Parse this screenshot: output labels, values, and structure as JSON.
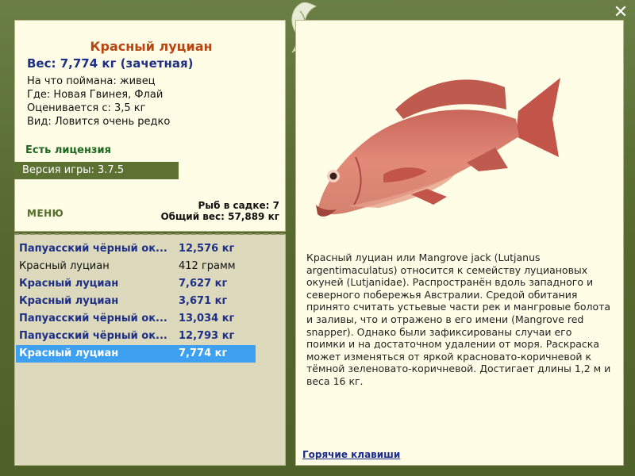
{
  "fish": {
    "title": "Красный луциан",
    "weight_line": "Вес: 7,774 кг (зачетная)",
    "caught_on": "На что поймана: живец",
    "where": "Где: Новая Гвинея, Флай",
    "rated_from": "Оценивается с: 3,5 кг",
    "kind": "Вид: Ловится очень редко",
    "description": "Красный луциан или Mangrove jack (Lutjanus argentimaculatus) относится к семейству луциановых окуней (Lutjanidae). Распространён вдоль западного и северного побережья Австралии. Средой обитания принято считать устьевые части рек и мангровые болота и заливы, что и отражено в его имени (Mangrove red snapper). Однако были зафиксированы случаи его поимки и на достаточном удалении от моря. Раскраска может изменяться от яркой красновато-коричневой к тёмной зеленовато-коричневой. Достигает длины 1,2 м и веса 16 кг."
  },
  "license": "Есть лицензия",
  "version": "Версия игры: 3.7.5",
  "menu_label": "МЕНЮ",
  "stats": {
    "fish_count": "Рыб в садке: 7",
    "total_weight": "Общий вес: 57,889 кг"
  },
  "catch_list": [
    {
      "name": "Папуасский чёрный ок...",
      "weight": "12,576 кг",
      "style": "trophy"
    },
    {
      "name": "Красный луциан",
      "weight": "412 грамм",
      "style": "plain"
    },
    {
      "name": "Красный луциан",
      "weight": "7,627 кг",
      "style": "trophy"
    },
    {
      "name": "Красный луциан",
      "weight": "3,671 кг",
      "style": "trophy"
    },
    {
      "name": "Папуасский чёрный ок...",
      "weight": "13,034 кг",
      "style": "trophy"
    },
    {
      "name": "Папуасский чёрный ок...",
      "weight": "12,793 кг",
      "style": "trophy"
    },
    {
      "name": "Красный луциан",
      "weight": "7,774 кг",
      "style": "selected"
    }
  ],
  "hotkeys_link": "Горячие клавиши",
  "colors": {
    "frame": "#5a6e3a",
    "panel": "#fffde6",
    "title": "#b94512",
    "trophy": "#1e2f86",
    "selected": "#3ea0f0",
    "license": "#1d6a1f"
  },
  "icons": {
    "close": "close-icon",
    "decoration": "leaf-lizard-icon",
    "fish": "red-snapper-image"
  }
}
